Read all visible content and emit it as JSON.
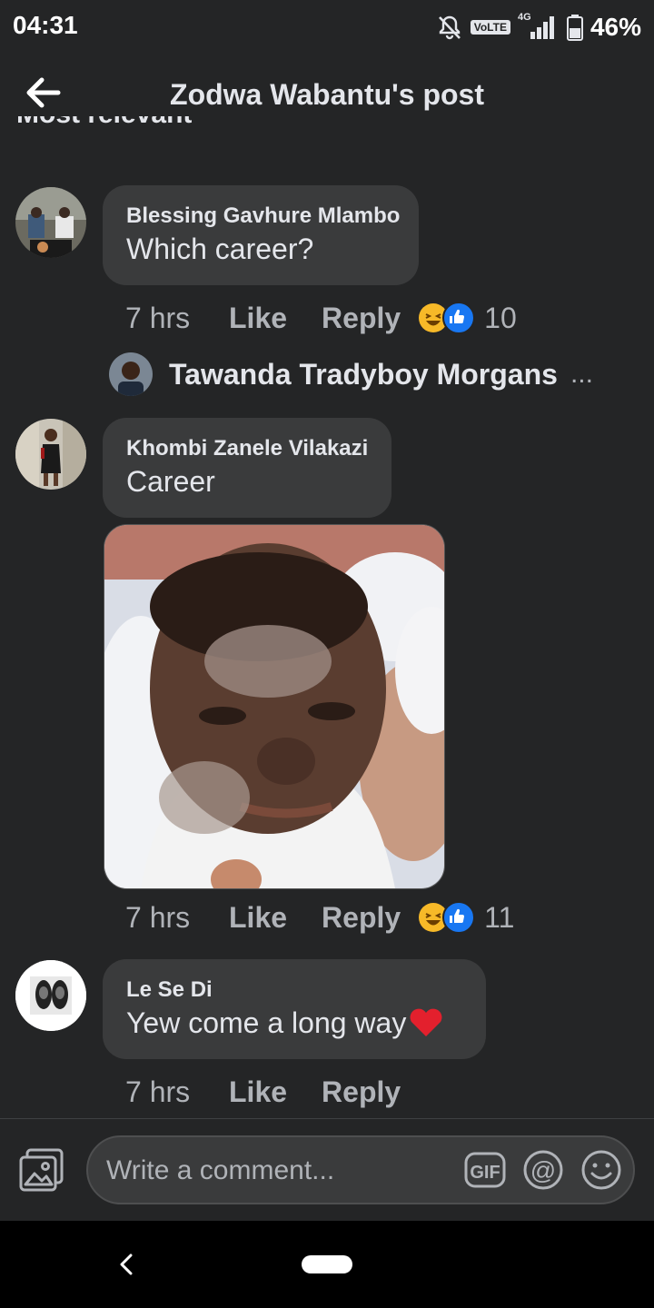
{
  "status_bar": {
    "time": "04:31",
    "network_badge": "VoLTE",
    "network_type": "4G",
    "battery": "46%"
  },
  "header": {
    "title": "Zodwa Wabantu's post",
    "sort_label": "Most relevant"
  },
  "comments": [
    {
      "author": "Blessing Gavhure Mlambo",
      "text": "Which career?",
      "time": "7 hrs",
      "like_label": "Like",
      "reply_label": "Reply",
      "reaction_count": "10",
      "reactions": [
        "haha",
        "like"
      ],
      "reply_preview": {
        "name": "Tawanda Tradyboy Morgans",
        "more": "..."
      }
    },
    {
      "author": "Khombi Zanele Vilakazi",
      "text": "Career",
      "time": "7 hrs",
      "like_label": "Like",
      "reply_label": "Reply",
      "reaction_count": "11",
      "reactions": [
        "haha",
        "like"
      ]
    },
    {
      "author": "Le Se Di",
      "text": "Yew come a long way",
      "emoji": "red-heart",
      "time": "7 hrs",
      "like_label": "Like",
      "reply_label": "Reply"
    }
  ],
  "composer": {
    "placeholder": "Write a comment...",
    "gif_label": "GIF",
    "mention_label": "@"
  },
  "colors": {
    "background": "#242526",
    "bubble": "#3a3b3c",
    "text": "#e4e6eb",
    "muted": "#b0b3b8",
    "like_blue": "#1877f2",
    "haha_yellow": "#f7b928"
  }
}
